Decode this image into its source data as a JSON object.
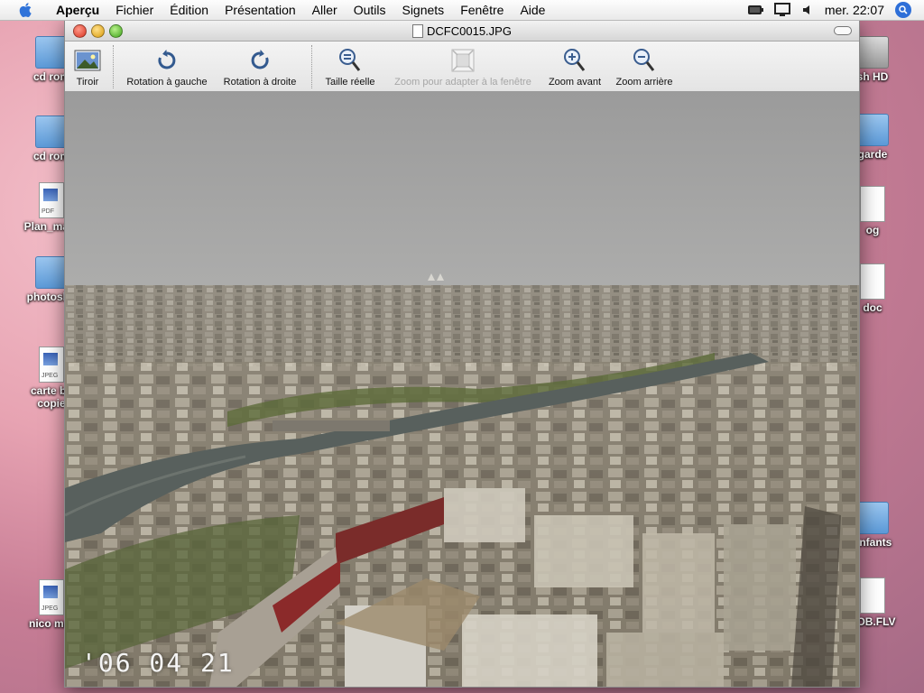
{
  "menubar": {
    "app_name": "Aperçu",
    "menus": [
      "Fichier",
      "Édition",
      "Présentation",
      "Aller",
      "Outils",
      "Signets",
      "Fenêtre",
      "Aide"
    ],
    "clock": "mer. 22:07",
    "status_icons": [
      "battery-icon",
      "display-icon",
      "volume-icon",
      "spotlight-icon"
    ]
  },
  "desktop": {
    "left_items": [
      {
        "label": "cd rom",
        "type": "folder"
      },
      {
        "label": "cd rom",
        "type": "folder"
      },
      {
        "label": "Plan_mars",
        "type": "pdf",
        "tag": "PDF"
      },
      {
        "label": "photosho",
        "type": "folder"
      },
      {
        "label": "carte ba",
        "label2": "copie",
        "type": "jpeg",
        "tag": "JPEG"
      },
      {
        "label": "nico mar",
        "type": "jpeg",
        "tag": "JPEG"
      }
    ],
    "right_items": [
      {
        "label": "sh HD"
      },
      {
        "label": "garde"
      },
      {
        "label": "og"
      },
      {
        "label": "doc"
      },
      {
        "label": "enfants"
      },
      {
        "label": "VOB.FLV"
      }
    ]
  },
  "window": {
    "title": "DCFC0015.JPG",
    "toolbar": {
      "drawer": "Tiroir",
      "rotate_left": "Rotation à gauche",
      "rotate_right": "Rotation à droite",
      "actual_size": "Taille réelle",
      "zoom_to_fit": "Zoom pour adapter à la fenêtre",
      "zoom_in": "Zoom avant",
      "zoom_out": "Zoom arrière"
    },
    "photo": {
      "date_stamp": "'06 04 21"
    }
  },
  "colors": {
    "accent": "#2e6fd8",
    "disabled_text": "#a6a6a6"
  }
}
